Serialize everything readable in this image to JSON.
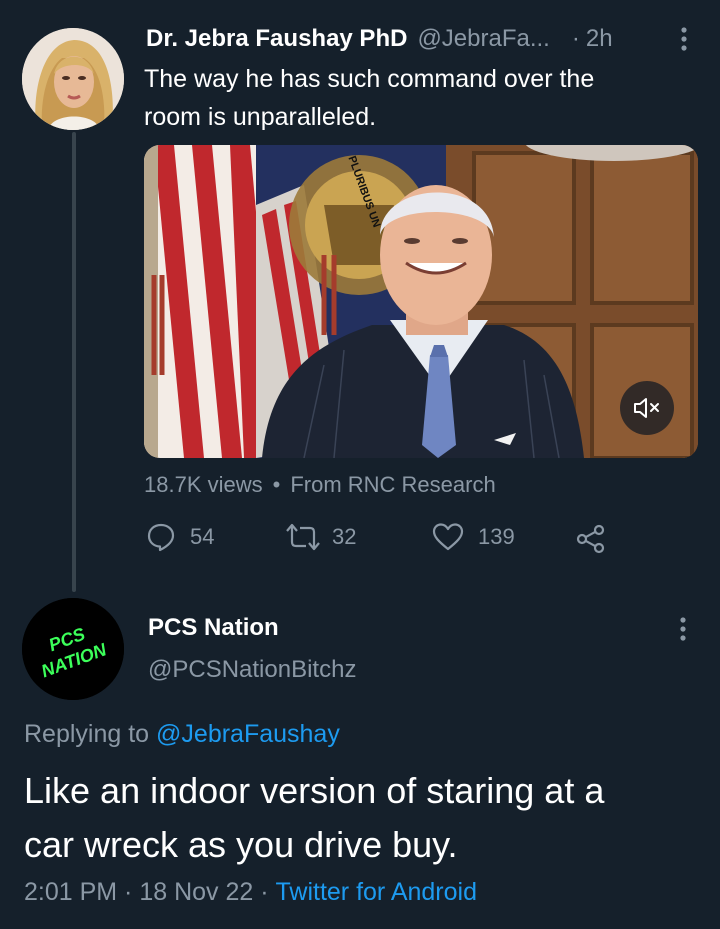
{
  "tweet": {
    "author_name": "Dr. Jebra Faushay PhD",
    "handle": "@JebraFa...",
    "separator": "·",
    "time": "2h",
    "text_line1": "The way he has such command over the",
    "text_line2": "room is unparalleled.",
    "video": {
      "seal_text": "PLURIBUS UN",
      "mute_icon": "volume-off-icon"
    },
    "views": "18.7K views",
    "dot": "•",
    "source": "From RNC Research",
    "replies": "54",
    "retweets": "32",
    "likes": "139"
  },
  "reply": {
    "avatar_text_line1": "PCS",
    "avatar_text_line2": "NATION",
    "author_name": "PCS Nation",
    "handle": "@PCSNationBitchz",
    "replying_prefix": "Replying to ",
    "replying_to": "@JebraFaushay",
    "text_line1": "Like an indoor version of staring at a",
    "text_line2": "car wreck as you drive buy.",
    "time": "2:01 PM",
    "sep1": " · ",
    "date": "18 Nov 22",
    "sep2": " · ",
    "client": "Twitter for Android"
  },
  "colors": {
    "background": "#15202b",
    "text": "#ffffff",
    "muted": "#8b98a5",
    "link": "#1d9bf0",
    "thread_line": "#38444d",
    "avatar_neon": "#3cff5a"
  }
}
